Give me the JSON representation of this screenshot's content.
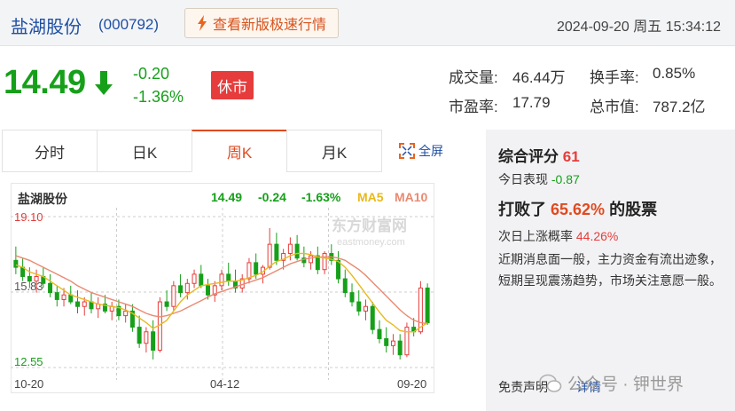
{
  "header": {
    "stock_name": "盐湖股份",
    "stock_code": "(000792)",
    "fast_button": "查看新版极速行情",
    "datetime": "2024-09-20 周五 15:34:12"
  },
  "quote": {
    "price": "14.49",
    "change_abs": "-0.20",
    "change_pct": "-1.36%",
    "market_status": "休市",
    "volume_label": "成交量:",
    "volume": "46.44万",
    "turnover_label": "换手率:",
    "turnover": "0.85%",
    "pe_label": "市盈率:",
    "pe": "17.79",
    "mcap_label": "总市值:",
    "mcap": "787.2亿"
  },
  "tabs": [
    "分时",
    "日K",
    "周K",
    "月K"
  ],
  "active_tab": "周K",
  "fullscreen_label": "全屏",
  "colors": {
    "up": "#e63c3c",
    "down": "#16a01a",
    "ma5": "#e8b91f",
    "ma10": "#e98a72",
    "accent": "#e04a1f"
  },
  "chart_data": {
    "type": "candlestick",
    "legend": {
      "name": "盐湖股份",
      "price": "14.49",
      "change": "-0.24",
      "pct": "-1.63%",
      "ma5": "MA5",
      "ma10": "MA10"
    },
    "y_ticks": [
      "19.10",
      "15.83",
      "12.55"
    ],
    "ylim": [
      12.55,
      19.1
    ],
    "x_ticks": [
      "10-20",
      "04-12",
      "09-20"
    ],
    "watermark": "东方财富网",
    "watermark_sub": "eastmoney.com",
    "candles": [
      [
        17.2,
        17.8,
        16.6,
        16.9
      ],
      [
        16.9,
        17.3,
        16.3,
        16.5
      ],
      [
        16.5,
        16.9,
        16.0,
        16.3
      ],
      [
        16.3,
        16.8,
        15.8,
        16.5
      ],
      [
        16.5,
        16.9,
        16.0,
        16.2
      ],
      [
        16.2,
        16.6,
        15.6,
        15.8
      ],
      [
        15.8,
        16.1,
        15.2,
        15.5
      ],
      [
        15.5,
        16.0,
        15.2,
        15.7
      ],
      [
        15.7,
        16.1,
        15.3,
        15.4
      ],
      [
        15.4,
        15.9,
        14.9,
        15.2
      ],
      [
        15.2,
        15.6,
        14.8,
        15.4
      ],
      [
        15.4,
        15.8,
        14.9,
        15.1
      ],
      [
        15.1,
        15.6,
        14.7,
        15.3
      ],
      [
        15.3,
        15.7,
        14.9,
        15.0
      ],
      [
        15.0,
        15.4,
        14.6,
        15.2
      ],
      [
        15.2,
        15.5,
        14.6,
        14.8
      ],
      [
        14.8,
        15.3,
        14.5,
        15.0
      ],
      [
        15.0,
        15.3,
        14.1,
        14.3
      ],
      [
        14.3,
        14.8,
        13.4,
        13.6
      ],
      [
        13.6,
        14.3,
        13.2,
        14.1
      ],
      [
        14.1,
        14.6,
        12.9,
        13.3
      ],
      [
        13.3,
        15.6,
        13.2,
        15.4
      ],
      [
        15.4,
        15.9,
        15.0,
        15.2
      ],
      [
        15.2,
        16.3,
        15.0,
        16.1
      ],
      [
        16.1,
        16.6,
        15.6,
        15.8
      ],
      [
        15.8,
        16.4,
        15.5,
        16.2
      ],
      [
        16.2,
        16.8,
        16.0,
        16.6
      ],
      [
        16.6,
        17.0,
        16.0,
        16.1
      ],
      [
        16.1,
        16.4,
        15.5,
        15.7
      ],
      [
        15.7,
        16.3,
        15.4,
        16.1
      ],
      [
        16.1,
        16.8,
        15.9,
        16.6
      ],
      [
        16.6,
        17.1,
        16.1,
        16.3
      ],
      [
        16.3,
        16.8,
        15.8,
        16.0
      ],
      [
        16.0,
        16.6,
        15.8,
        16.4
      ],
      [
        16.4,
        17.3,
        16.2,
        17.1
      ],
      [
        17.1,
        17.5,
        16.4,
        16.6
      ],
      [
        16.6,
        17.0,
        16.2,
        16.9
      ],
      [
        16.9,
        18.6,
        16.8,
        17.9
      ],
      [
        17.9,
        18.4,
        17.0,
        17.2
      ],
      [
        17.2,
        17.7,
        16.8,
        17.5
      ],
      [
        17.5,
        18.2,
        17.2,
        17.9
      ],
      [
        17.9,
        18.3,
        17.2,
        17.3
      ],
      [
        17.3,
        17.8,
        16.9,
        17.1
      ],
      [
        17.1,
        17.6,
        16.8,
        17.4
      ],
      [
        17.4,
        17.8,
        16.6,
        16.8
      ],
      [
        16.8,
        17.6,
        16.6,
        17.5
      ],
      [
        17.5,
        17.9,
        17.0,
        17.2
      ],
      [
        17.2,
        17.6,
        16.2,
        16.4
      ],
      [
        16.4,
        16.8,
        15.6,
        15.8
      ],
      [
        15.8,
        16.2,
        15.2,
        15.4
      ],
      [
        15.4,
        15.9,
        14.8,
        15.0
      ],
      [
        15.0,
        15.5,
        14.6,
        15.2
      ],
      [
        15.2,
        15.4,
        14.0,
        14.2
      ],
      [
        14.2,
        14.6,
        13.6,
        13.8
      ],
      [
        13.8,
        14.3,
        13.2,
        13.5
      ],
      [
        13.5,
        14.0,
        13.1,
        13.7
      ],
      [
        13.7,
        14.0,
        12.9,
        13.1
      ],
      [
        13.1,
        14.5,
        13.0,
        14.3
      ],
      [
        14.3,
        14.7,
        13.9,
        14.1
      ],
      [
        14.1,
        16.3,
        14.0,
        16.0
      ],
      [
        16.0,
        16.2,
        14.4,
        14.49
      ]
    ],
    "ma5": [
      17.0,
      16.9,
      16.7,
      16.6,
      16.5,
      16.3,
      16.1,
      15.9,
      15.7,
      15.6,
      15.5,
      15.4,
      15.3,
      15.25,
      15.2,
      15.15,
      15.05,
      14.9,
      14.7,
      14.5,
      14.25,
      14.4,
      14.6,
      15.0,
      15.4,
      15.7,
      15.9,
      16.1,
      16.15,
      16.2,
      16.25,
      16.3,
      16.3,
      16.35,
      16.45,
      16.55,
      16.7,
      16.95,
      17.15,
      17.25,
      17.4,
      17.5,
      17.5,
      17.45,
      17.35,
      17.3,
      17.25,
      17.15,
      16.9,
      16.55,
      16.15,
      15.75,
      15.35,
      14.95,
      14.6,
      14.4,
      14.15,
      14.1,
      14.1,
      14.3,
      14.5
    ],
    "ma10": [
      17.4,
      17.3,
      17.2,
      17.05,
      16.9,
      16.75,
      16.6,
      16.45,
      16.3,
      16.1,
      15.95,
      15.8,
      15.7,
      15.6,
      15.5,
      15.4,
      15.3,
      15.2,
      15.05,
      14.9,
      14.8,
      14.75,
      14.8,
      14.9,
      15.0,
      15.15,
      15.3,
      15.45,
      15.6,
      15.75,
      15.85,
      15.95,
      16.05,
      16.15,
      16.25,
      16.35,
      16.45,
      16.6,
      16.75,
      16.9,
      17.05,
      17.15,
      17.25,
      17.3,
      17.35,
      17.35,
      17.35,
      17.3,
      17.2,
      17.0,
      16.8,
      16.55,
      16.25,
      15.95,
      15.65,
      15.35,
      15.05,
      14.8,
      14.6,
      14.5,
      14.45
    ]
  },
  "panel": {
    "title": "综合评分",
    "score": "61",
    "today_label": "今日表现",
    "today_value": "-0.87",
    "beat_prefix": "打败了",
    "beat_pct": "65.62%",
    "beat_suffix": "的股票",
    "prob_label": "次日上涨概率",
    "prob_value": "44.26%",
    "description": "近期消息面一般，主力资金有流出迹象，短期呈现震荡趋势，市场关注意愿一般。",
    "disclaimer": "免责声明",
    "detail_link": "详情"
  },
  "watermark": {
    "text": "公众号 · 钾世界"
  }
}
